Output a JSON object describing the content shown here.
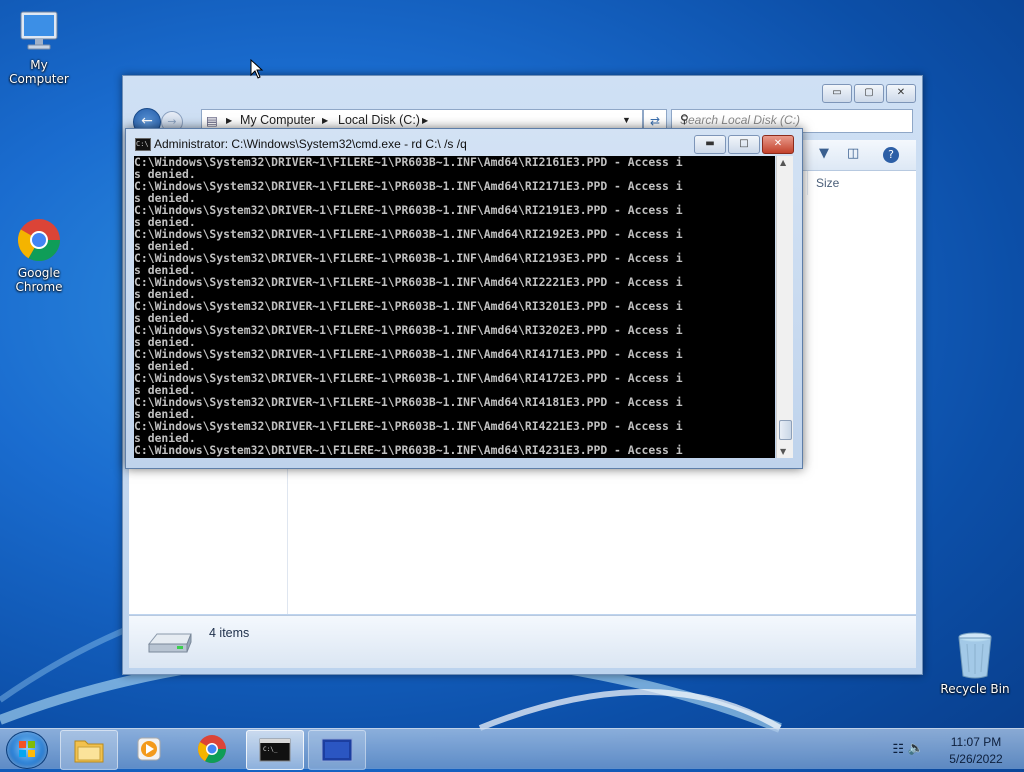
{
  "desktop": {
    "icons": [
      {
        "label": "My Computer"
      },
      {
        "label": "Google Chrome"
      },
      {
        "label": "Recycle Bin"
      }
    ]
  },
  "explorer": {
    "address": {
      "crumbs": [
        "My Computer",
        "Local Disk (C:)"
      ]
    },
    "search_placeholder": "Search Local Disk (C:)",
    "column_header": "Size",
    "status": {
      "item_count": "4 items"
    },
    "caption_buttons": {
      "minimize": "▭",
      "maximize": "▢",
      "close": "✕"
    }
  },
  "cmd": {
    "title": "Administrator: C:\\Windows\\System32\\cmd.exe - rd  C:\\ /s /q",
    "icon_text": "C:\\",
    "lines": [
      "C:\\Windows\\System32\\DRIVER~1\\FILERE~1\\PR603B~1.INF\\Amd64\\RI2161E3.PPD - Access i",
      "s denied.",
      "C:\\Windows\\System32\\DRIVER~1\\FILERE~1\\PR603B~1.INF\\Amd64\\RI2171E3.PPD - Access i",
      "s denied.",
      "C:\\Windows\\System32\\DRIVER~1\\FILERE~1\\PR603B~1.INF\\Amd64\\RI2191E3.PPD - Access i",
      "s denied.",
      "C:\\Windows\\System32\\DRIVER~1\\FILERE~1\\PR603B~1.INF\\Amd64\\RI2192E3.PPD - Access i",
      "s denied.",
      "C:\\Windows\\System32\\DRIVER~1\\FILERE~1\\PR603B~1.INF\\Amd64\\RI2193E3.PPD - Access i",
      "s denied.",
      "C:\\Windows\\System32\\DRIVER~1\\FILERE~1\\PR603B~1.INF\\Amd64\\RI2221E3.PPD - Access i",
      "s denied.",
      "C:\\Windows\\System32\\DRIVER~1\\FILERE~1\\PR603B~1.INF\\Amd64\\RI3201E3.PPD - Access i",
      "s denied.",
      "C:\\Windows\\System32\\DRIVER~1\\FILERE~1\\PR603B~1.INF\\Amd64\\RI3202E3.PPD - Access i",
      "s denied.",
      "C:\\Windows\\System32\\DRIVER~1\\FILERE~1\\PR603B~1.INF\\Amd64\\RI4171E3.PPD - Access i",
      "s denied.",
      "C:\\Windows\\System32\\DRIVER~1\\FILERE~1\\PR603B~1.INF\\Amd64\\RI4172E3.PPD - Access i",
      "s denied.",
      "C:\\Windows\\System32\\DRIVER~1\\FILERE~1\\PR603B~1.INF\\Amd64\\RI4181E3.PPD - Access i",
      "s denied.",
      "C:\\Windows\\System32\\DRIVER~1\\FILERE~1\\PR603B~1.INF\\Amd64\\RI4221E3.PPD - Access i",
      "s denied.",
      "C:\\Windows\\System32\\DRIVER~1\\FILERE~1\\PR603B~1.INF\\Amd64\\RI4231E3.PPD - Access i"
    ]
  },
  "taskbar": {
    "items": [
      "start",
      "windows-explorer",
      "media-player",
      "google-chrome",
      "command-prompt",
      "remote-desktop"
    ],
    "clock": {
      "time": "11:07 PM",
      "date": "5/26/2022"
    }
  },
  "colors": {
    "accent": "#1a6ccf",
    "console_bg": "#000000",
    "console_fg": "#c0c0c0"
  }
}
